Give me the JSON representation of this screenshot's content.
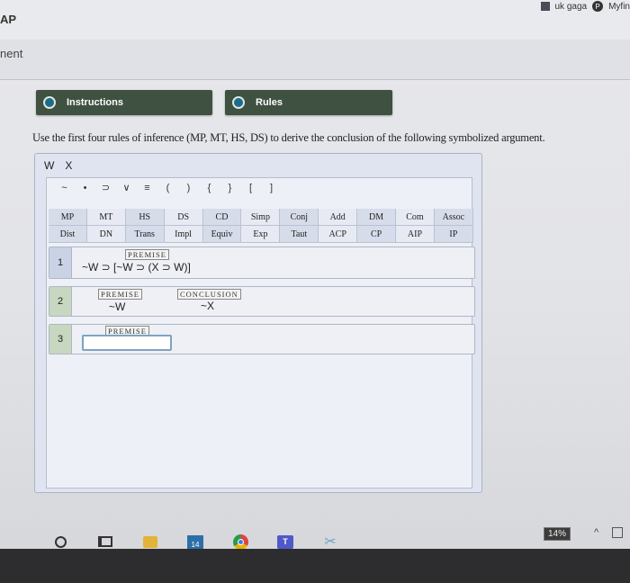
{
  "browser": {
    "top_left_text": "AP",
    "sub_left_text": "nent",
    "top_right_items": [
      "uk gaga",
      "Myfin"
    ]
  },
  "tabs": {
    "instructions": "Instructions",
    "rules": "Rules"
  },
  "instruction_text": "Use the first four rules of inference (MP, MT, HS, DS) to derive the conclusion of the following symbolized argument.",
  "variables": [
    "W",
    "X"
  ],
  "symbols": [
    "~",
    "•",
    "⊃",
    "∨",
    "≡",
    "(",
    ")",
    "{",
    "}",
    "[",
    "]"
  ],
  "rules": [
    [
      "MP",
      "MT",
      "HS",
      "DS",
      "CD",
      "Simp",
      "Conj",
      "Add",
      "DM",
      "Com",
      "Assoc"
    ],
    [
      "Dist",
      "DN",
      "Trans",
      "Impl",
      "Equiv",
      "Exp",
      "Taut",
      "ACP",
      "CP",
      "AIP",
      "IP"
    ]
  ],
  "lines": [
    {
      "number": "1",
      "tag": "PREMISE",
      "formula": "~W ⊃ [~W ⊃ (X ⊃ W)]"
    },
    {
      "number": "2",
      "tag": "PREMISE",
      "formula": "~W",
      "tag2": "CONCLUSION",
      "formula2": "~X"
    },
    {
      "number": "3",
      "tag": "PREMISE",
      "input_value": ""
    }
  ],
  "status": {
    "percent": "14%",
    "calendar_day": "14"
  }
}
